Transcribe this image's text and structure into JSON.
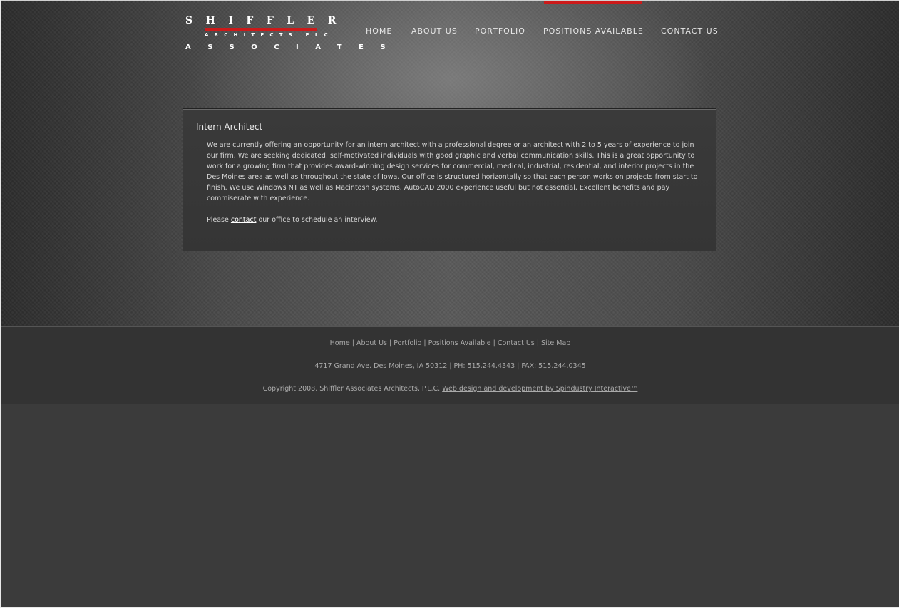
{
  "logo": {
    "line1": "SHIFFLER",
    "line2": "ARCHITECTS PLC",
    "line3": "ASSOCIATES"
  },
  "nav": {
    "active": "POSITIONS AVAILABLE",
    "items": [
      {
        "label": "HOME"
      },
      {
        "label": "ABOUT US"
      },
      {
        "label": "PORTFOLIO"
      },
      {
        "label": "POSITIONS AVAILABLE"
      },
      {
        "label": "CONTACT US"
      }
    ]
  },
  "content": {
    "title": "Intern Architect",
    "body": "We are currently offering an opportunity for an intern architect with a professional degree or an architect with 2 to 5 years of experience to join our firm. We are seeking dedicated, self-motivated individuals with good graphic and verbal communication skills. This is a great opportunity to work for a growing firm that provides award-winning design services for commercial, medical, industrial, residential, and interior projects in the Des Moines area as well as throughout the state of Iowa. Our office is structured horizontally so that each person works on projects from start to finish. We use Windows NT as well as Macintosh systems. AutoCAD 2000 experience useful but not essential. Excellent benefits and pay commiserate with experience.",
    "please_prefix": "Please",
    "contact_link": "contact",
    "please_suffix": "our office to schedule an interview."
  },
  "footer": {
    "links": [
      {
        "label": "Home"
      },
      {
        "label": "About Us"
      },
      {
        "label": "Portfolio"
      },
      {
        "label": "Positions Available"
      },
      {
        "label": "Contact Us"
      },
      {
        "label": "Site Map"
      }
    ],
    "separator": "|",
    "address": "4717 Grand Ave. Des Moines, IA 50312 | PH: 515.244.4343 | FAX: 515.244.0345",
    "copyright": "Copyright 2008. Shiffler Associates Architects, P.L.C.",
    "credit_link": "Web design and development by Spindustry Interactive™"
  },
  "colors": {
    "accent": "#cc1a1a",
    "background": "#3b3b3b",
    "text": "#d6d6d6"
  }
}
